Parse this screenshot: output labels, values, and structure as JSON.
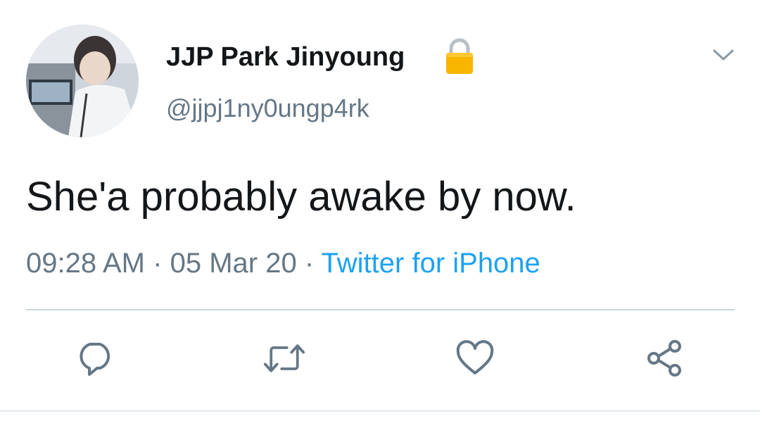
{
  "tweet": {
    "display_name": "JJP Park Jinyoung",
    "handle": "@jjpj1ny0ungp4rk",
    "text": "She'a probably awake by now.",
    "time": "09:28 AM",
    "date": "05 Mar 20",
    "separator": "·",
    "source": "Twitter for iPhone",
    "protected": true
  },
  "icons": {
    "protected": "lock-icon",
    "more": "chevron-down-icon",
    "reply": "reply-icon",
    "retweet": "retweet-icon",
    "like": "heart-icon",
    "share": "share-icon"
  },
  "colors": {
    "name": "#14171a",
    "secondary": "#657786",
    "link": "#1da1f2",
    "divider": "#ccd6dd",
    "lock": "#f7b500"
  }
}
